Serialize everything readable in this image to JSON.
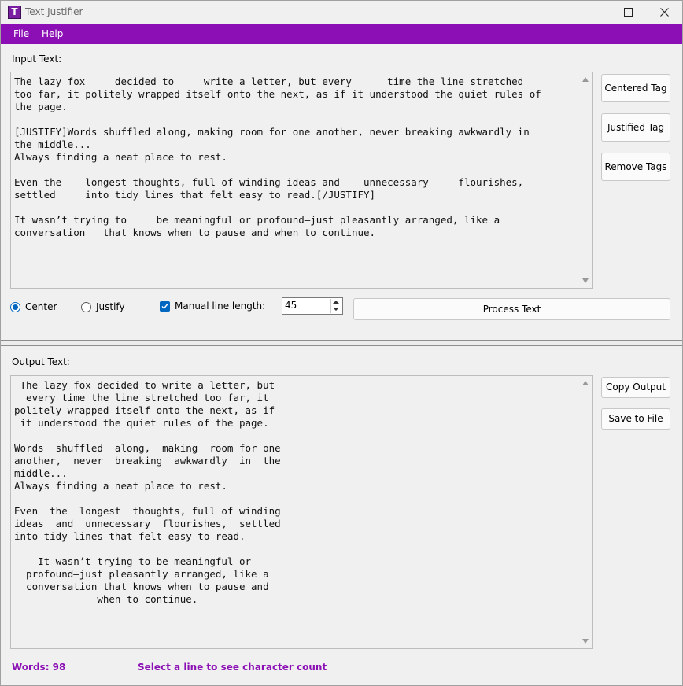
{
  "window": {
    "title": "Text Justifier",
    "icon_letter": "T"
  },
  "menu": {
    "items": [
      "File",
      "Help"
    ]
  },
  "input": {
    "label": "Input Text:",
    "text": "The lazy fox     decided to     write a letter, but every      time the line stretched\ntoo far, it politely wrapped itself onto the next, as if it understood the quiet rules of\nthe page.\n\n[JUSTIFY]Words shuffled along, making room for one another, never breaking awkwardly in\nthe middle...\nAlways finding a neat place to rest.\n\nEven the    longest thoughts, full of winding ideas and    unnecessary     flourishes,\nsettled     into tidy lines that felt easy to read.[/JUSTIFY]\n\nIt wasn’t trying to     be meaningful or profound—just pleasantly arranged, like a\nconversation   that knows when to pause and when to continue."
  },
  "tag_buttons": {
    "centered": "Centered Tag",
    "justified": "Justified Tag",
    "remove": "Remove Tags"
  },
  "options": {
    "center_label": "Center",
    "justify_label": "Justify",
    "selected_mode": "Center",
    "manual_length_label": "Manual line length:",
    "manual_length_checked": true,
    "line_length": "45",
    "process_label": "Process Text"
  },
  "output": {
    "label": "Output Text:",
    "text": " The lazy fox decided to write a letter, but\n  every time the line stretched too far, it\npolitely wrapped itself onto the next, as if\n it understood the quiet rules of the page.\n\nWords  shuffled  along,  making  room for one\nanother,  never  breaking  awkwardly  in  the\nmiddle...\nAlways finding a neat place to rest.\n\nEven  the  longest  thoughts, full of winding\nideas  and  unnecessary  flourishes,  settled\ninto tidy lines that felt easy to read.\n\n    It wasn’t trying to be meaningful or\n  profound—just pleasantly arranged, like a\n  conversation that knows when to pause and\n              when to continue."
  },
  "output_buttons": {
    "copy": "Copy Output",
    "save": "Save to File"
  },
  "status": {
    "words": "Words: 98",
    "hint": "Select a line to see character count"
  },
  "colors": {
    "accent": "#8b0fb4",
    "radio_check": "#0067c0"
  }
}
